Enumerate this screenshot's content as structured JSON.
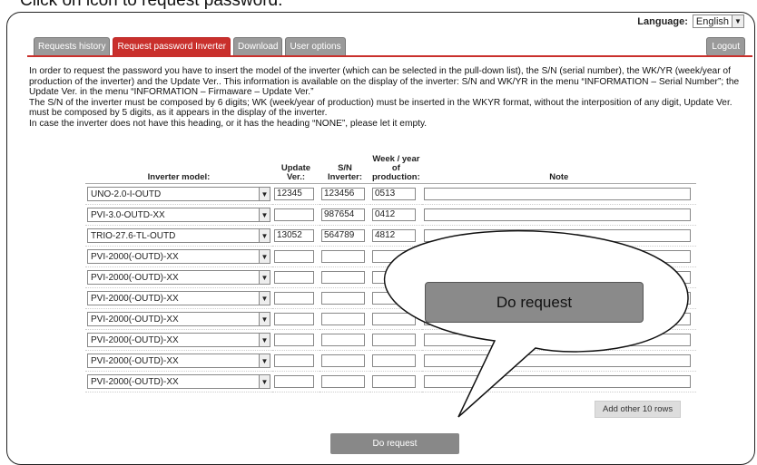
{
  "caption": "Click on icon to request password.",
  "language": {
    "label": "Language:",
    "value": "English"
  },
  "tabs": [
    "Requests history",
    "Request password Inverter",
    "Download",
    "User options"
  ],
  "logout_label": "Logout",
  "intro": [
    "In order to request the password you have to insert the model of the inverter (which can be selected in the pull-down list), the S/N (serial number), the WK/YR (week/year of production of the inverter) and the Update Ver.. This information is available on the display of the inverter: S/N and WK/YR in the menu “INFORMATION – Serial Number”; the Update Ver. in the menu “INFORMATION – Firmaware – Update Ver.”",
    "The S/N of the inverter must be composed by 6 digits; WK (week/year of production) must be inserted in the WKYR format, without the interposition of any digit, Update Ver. must be composed by 5 digits, as it appears in the display of the inverter.",
    "In case the inverter does not have this heading, or it has the heading “NONE”, please let it empty."
  ],
  "table": {
    "headers": {
      "model": "Inverter model:",
      "update": "Update Ver.:",
      "sn": "S/N Inverter:",
      "week": "Week / year of production:",
      "note": "Note"
    },
    "rows": [
      {
        "model": "UNO-2.0-I-OUTD",
        "update": "12345",
        "sn": "123456",
        "week": "0513",
        "note": ""
      },
      {
        "model": "PVI-3.0-OUTD-XX",
        "update": "",
        "sn": "987654",
        "week": "0412",
        "note": ""
      },
      {
        "model": "TRIO-27.6-TL-OUTD",
        "update": "13052",
        "sn": "564789",
        "week": "4812",
        "note": ""
      },
      {
        "model": "PVI-2000(-OUTD)-XX",
        "update": "",
        "sn": "",
        "week": "",
        "note": ""
      },
      {
        "model": "PVI-2000(-OUTD)-XX",
        "update": "",
        "sn": "",
        "week": "",
        "note": ""
      },
      {
        "model": "PVI-2000(-OUTD)-XX",
        "update": "",
        "sn": "",
        "week": "",
        "note": ""
      },
      {
        "model": "PVI-2000(-OUTD)-XX",
        "update": "",
        "sn": "",
        "week": "",
        "note": ""
      },
      {
        "model": "PVI-2000(-OUTD)-XX",
        "update": "",
        "sn": "",
        "week": "",
        "note": ""
      },
      {
        "model": "PVI-2000(-OUTD)-XX",
        "update": "",
        "sn": "",
        "week": "",
        "note": ""
      },
      {
        "model": "PVI-2000(-OUTD)-XX",
        "update": "",
        "sn": "",
        "week": "",
        "note": ""
      }
    ]
  },
  "add_rows_label": "Add other 10 rows",
  "do_request_label": "Do request",
  "callout_label": "Do request"
}
